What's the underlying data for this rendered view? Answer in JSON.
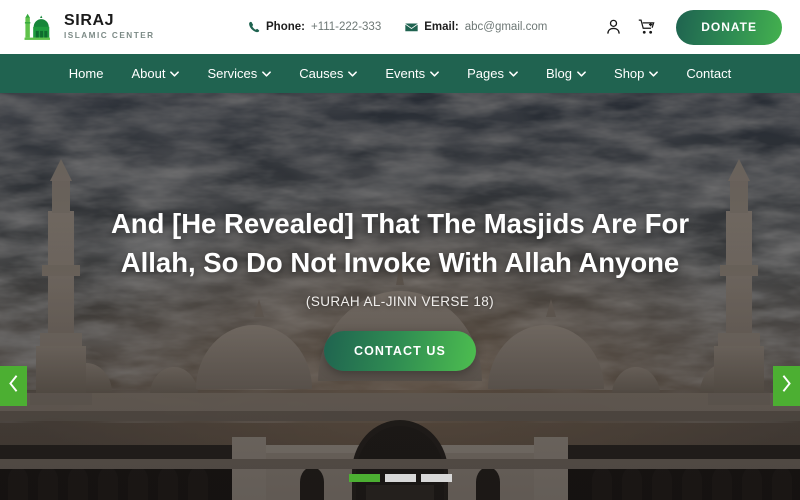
{
  "brand": {
    "name": "SIRAJ",
    "tagline": "ISLAMIC CENTER",
    "logo_icon": "mosque-icon"
  },
  "topbar": {
    "phone_label": "Phone:",
    "phone_value": "+111-222-333",
    "phone_icon": "phone-icon",
    "email_label": "Email:",
    "email_value": "abc@gmail.com",
    "email_icon": "envelope-icon",
    "account_icon": "user-icon",
    "cart_icon": "cart-plus-icon",
    "donate_label": "DONATE"
  },
  "nav": {
    "items": [
      {
        "label": "Home",
        "has_dropdown": false
      },
      {
        "label": "About",
        "has_dropdown": true
      },
      {
        "label": "Services",
        "has_dropdown": true
      },
      {
        "label": "Causes",
        "has_dropdown": true
      },
      {
        "label": "Events",
        "has_dropdown": true
      },
      {
        "label": "Pages",
        "has_dropdown": true
      },
      {
        "label": "Blog",
        "has_dropdown": true
      },
      {
        "label": "Shop",
        "has_dropdown": true
      },
      {
        "label": "Contact",
        "has_dropdown": false
      }
    ]
  },
  "hero": {
    "title": "And [He Revealed] That The Masjids Are For Allah, So Do Not Invoke With Allah Anyone",
    "subtitle": "(SURAH AL-JINN VERSE 18)",
    "cta_label": "CONTACT US",
    "prev_icon": "chevron-left-icon",
    "next_icon": "chevron-right-icon",
    "slides": [
      {
        "active": true
      },
      {
        "active": false
      },
      {
        "active": false
      }
    ]
  },
  "colors": {
    "nav_green": "#206350",
    "accent_green": "#4caf32",
    "brand_dark_green": "#1f6350",
    "donate_gradient_end": "#44b14e"
  }
}
